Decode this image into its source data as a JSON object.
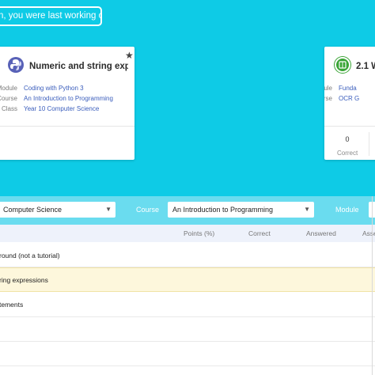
{
  "banner": {
    "last_working_label": "n, you were last working on",
    "bg_color": "#0ecbe6"
  },
  "cards": [
    {
      "title": "Numeric and string expr...",
      "logo": "python-logo",
      "starred": true,
      "star_icon": "★",
      "meta": [
        {
          "key": "Module",
          "value": "Coding with Python 3"
        },
        {
          "key": "Course",
          "value": "An Introduction to Programming"
        },
        {
          "key": "Class",
          "value": "Year 10 Computer Science"
        }
      ]
    },
    {
      "title": "2.1 W",
      "logo": "green-badge-logo",
      "meta": [
        {
          "key": "Module",
          "value": "Funda"
        },
        {
          "key": "Course",
          "value": "OCR G"
        }
      ],
      "stats": [
        {
          "value": "0",
          "label": "Correct"
        }
      ]
    }
  ],
  "filters": {
    "class_value": "Computer Science",
    "course_label": "Course",
    "course_value": "An Introduction to Programming",
    "module_label": "Module",
    "arrow": "▼"
  },
  "table": {
    "headers": [
      "Points (%)",
      "Correct",
      "Answered",
      "Asse"
    ],
    "rows": [
      {
        "label": "round (not a tutorial)",
        "highlighted": false
      },
      {
        "label": "ring expressions",
        "highlighted": true
      },
      {
        "label": "tements",
        "highlighted": false
      },
      {
        "label": "",
        "highlighted": false
      },
      {
        "label": "",
        "highlighted": false
      }
    ]
  }
}
